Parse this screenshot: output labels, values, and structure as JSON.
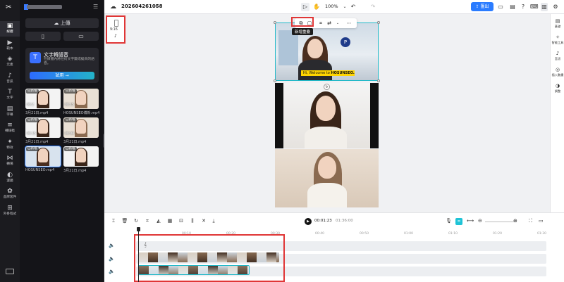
{
  "rail": {
    "items": [
      {
        "label": "媒體",
        "icon": "media-icon"
      },
      {
        "label": "範本",
        "icon": "template-icon"
      },
      {
        "label": "元素",
        "icon": "elements-icon"
      },
      {
        "label": "音訊",
        "icon": "audio-icon"
      },
      {
        "label": "文字",
        "icon": "text-icon"
      },
      {
        "label": "字幕",
        "icon": "captions-icon"
      },
      {
        "label": "轉錄稿",
        "icon": "transcript-icon"
      },
      {
        "label": "特效",
        "icon": "effects-icon"
      },
      {
        "label": "轉場",
        "icon": "transition-icon"
      },
      {
        "label": "濾鏡",
        "icon": "filter-icon"
      },
      {
        "label": "品牌套件",
        "icon": "brand-kit-icon"
      },
      {
        "label": "外掛程式",
        "icon": "plugins-icon"
      }
    ]
  },
  "panel": {
    "upload_label": "上傳",
    "promo": {
      "title": "文字轉語音",
      "description": "在媒體內將任何文字變成擬真的語音。",
      "button": "試用 →"
    },
    "media": [
      {
        "badge": "已新增",
        "duration": "00:2",
        "name": "3月21日.mp4"
      },
      {
        "badge": "已新增",
        "duration": "00:15",
        "name": "HOSUNSEO博新.mp4"
      },
      {
        "badge": "已新增",
        "duration": "00:15",
        "name": "3月21日.mp4"
      },
      {
        "badge": "已新增",
        "duration": "00:08",
        "name": "3月21日.mp4"
      },
      {
        "badge": "已新增",
        "duration": "",
        "name": "HOSUNSEO.mp4"
      },
      {
        "badge": "已新增",
        "duration": "",
        "name": "3月21日.mp4"
      }
    ]
  },
  "topbar": {
    "project_title": "202604261058",
    "zoom": "100%",
    "export": "匯出"
  },
  "canvas": {
    "ratio_label": "9:16",
    "tooltip": "新增重疊",
    "banner_prefix": "Hi, Welcome to",
    "banner_brand": "HOSUNSEO."
  },
  "right_rail": [
    {
      "label": "基礎",
      "icon": "basic-icon"
    },
    {
      "label": "智能工具",
      "icon": "smart-tools-icon"
    },
    {
      "label": "音訊",
      "icon": "audio-icon"
    },
    {
      "label": "插入動畫",
      "icon": "animation-icon"
    },
    {
      "label": "調整",
      "icon": "adjust-icon"
    }
  ],
  "timeline": {
    "current_time": "00:01:23",
    "total_time": "01:36:00",
    "ruler": [
      "00:10",
      "00:20",
      "00:30",
      "00:40",
      "00:50",
      "01:00",
      "01:10",
      "01:20",
      "01:30"
    ]
  },
  "colors": {
    "accent": "#2b7cff",
    "highlight": "#e03636",
    "selection": "#20b8c8"
  }
}
